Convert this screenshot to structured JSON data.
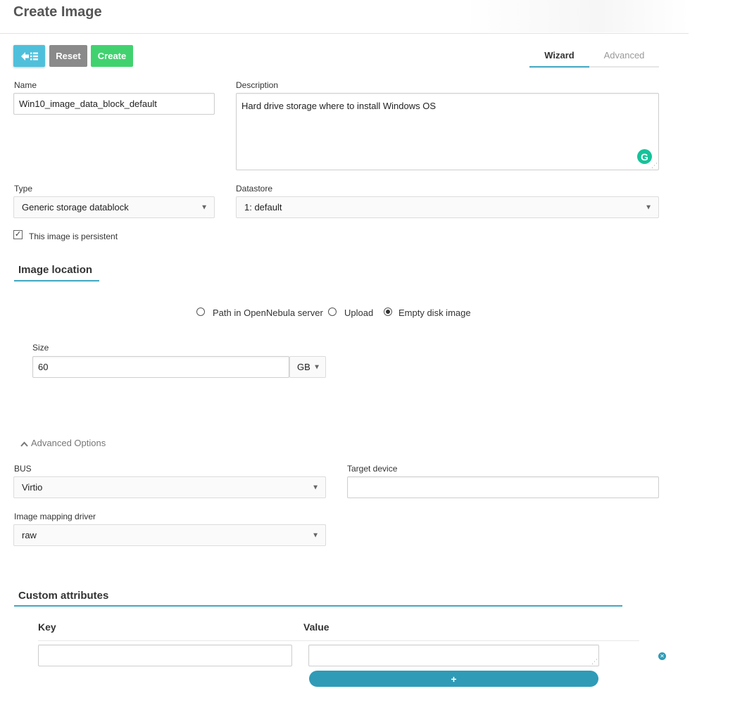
{
  "page": {
    "title": "Create Image"
  },
  "toolbar": {
    "back_icon": "back-list-icon",
    "reset_label": "Reset",
    "create_label": "Create"
  },
  "tabs": {
    "wizard": "Wizard",
    "advanced": "Advanced",
    "active": "Wizard"
  },
  "form": {
    "name_label": "Name",
    "name_value": "Win10_image_data_block_default",
    "description_label": "Description",
    "description_value": "Hard drive storage where to install Windows OS",
    "type_label": "Type",
    "type_value": "Generic storage datablock",
    "datastore_label": "Datastore",
    "datastore_value": "1: default",
    "persistent_label": "This image is persistent",
    "persistent_checked": true
  },
  "image_location": {
    "title": "Image location",
    "options": [
      "Path in OpenNebula server",
      "Upload",
      "Empty disk image"
    ],
    "selected": "Empty disk image",
    "size_label": "Size",
    "size_value": "60",
    "size_unit": "GB"
  },
  "advanced_options": {
    "toggle_label": "Advanced Options",
    "bus_label": "BUS",
    "bus_value": "Virtio",
    "target_device_label": "Target device",
    "target_device_value": "",
    "mapping_driver_label": "Image mapping driver",
    "mapping_driver_value": "raw"
  },
  "custom_attributes": {
    "title": "Custom attributes",
    "key_header": "Key",
    "value_header": "Value",
    "add_label": "+",
    "rows": [
      {
        "key": "",
        "value": ""
      }
    ]
  },
  "colors": {
    "accent": "#41a6c1",
    "create": "#41d26f",
    "reset": "#8a8a8a",
    "back": "#4fc0db"
  }
}
